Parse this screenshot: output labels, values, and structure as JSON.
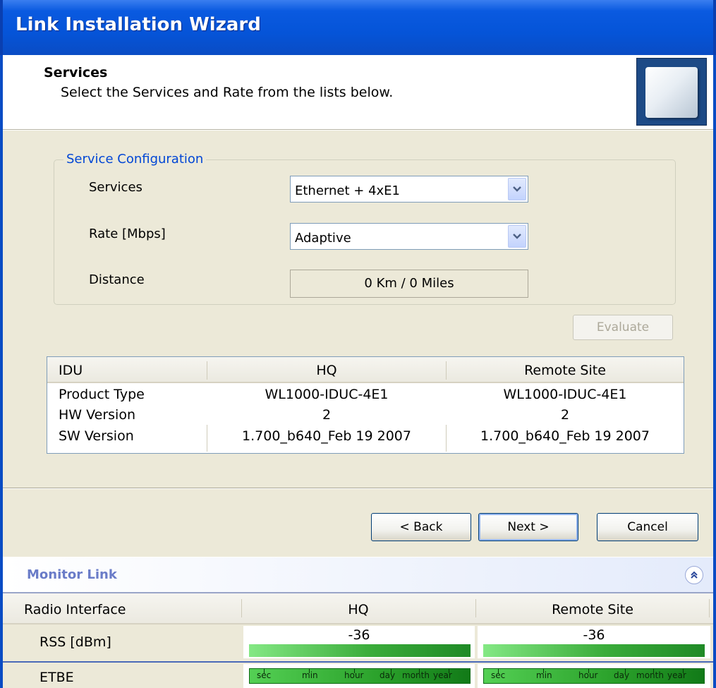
{
  "window": {
    "title": "Link Installation Wizard"
  },
  "header": {
    "title": "Services",
    "subtitle": "Select the Services and Rate from the lists below."
  },
  "service_config": {
    "legend": "Service Configuration",
    "services_label": "Services",
    "services_value": "Ethernet + 4xE1",
    "rate_label": "Rate [Mbps]",
    "rate_value": "Adaptive",
    "distance_label": "Distance",
    "distance_value": "0 Km / 0 Miles",
    "evaluate_label": "Evaluate"
  },
  "idu_table": {
    "headers": [
      "IDU",
      "HQ",
      "Remote Site"
    ],
    "rows": [
      [
        "Product Type",
        "WL1000-IDUC-4E1",
        "WL1000-IDUC-4E1"
      ],
      [
        "HW Version",
        "2",
        "2"
      ],
      [
        "SW Version",
        "1.700_b640_Feb 19 2007",
        "1.700_b640_Feb 19 2007"
      ]
    ]
  },
  "buttons": {
    "back": "< Back",
    "next": "Next >",
    "cancel": "Cancel"
  },
  "monitor": {
    "title": "Monitor Link",
    "headers": [
      "Radio Interface",
      "HQ",
      "Remote Site"
    ],
    "rss_label": "RSS [dBm]",
    "rss_hq": "-36",
    "rss_remote": "-36",
    "etbe_label": "ETBE",
    "etbe_scale": [
      "sec",
      "min",
      "hour",
      "day",
      "month",
      "year"
    ]
  }
}
